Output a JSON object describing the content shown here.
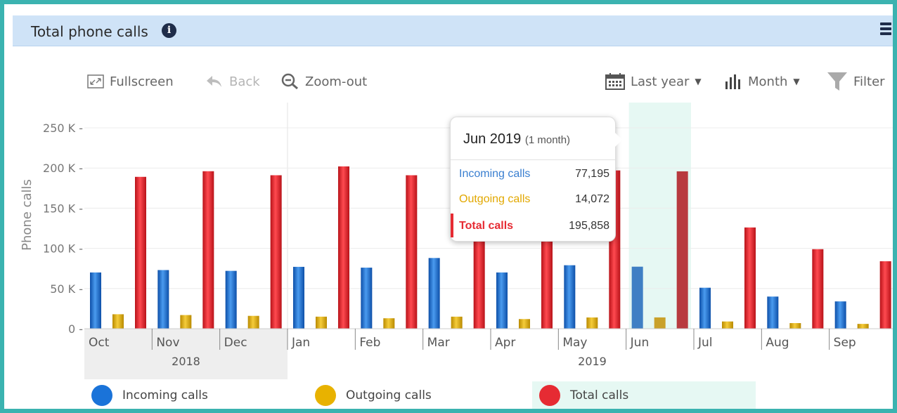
{
  "widget": {
    "title": "Total phone calls"
  },
  "toolbar": {
    "fullscreen": "Fullscreen",
    "back": "Back",
    "zoom_out": "Zoom-out",
    "period": "Last year",
    "granularity": "Month",
    "filter": "Filter"
  },
  "tooltip": {
    "title": "Jun 2019",
    "subtitle": "(1 month)",
    "rows": [
      {
        "label": "Incoming calls",
        "value": "77,195"
      },
      {
        "label": "Outgoing calls",
        "value": "14,072"
      },
      {
        "label": "Total calls",
        "value": "195,858"
      }
    ]
  },
  "colors": {
    "incoming": "#1a73d9",
    "outgoing": "#e8b200",
    "total": "#e62b33",
    "frame": "#3bb3b0",
    "header": "#cfe3f7"
  },
  "chart_data": {
    "type": "bar",
    "ylabel": "Phone calls",
    "ylim": [
      0,
      250000
    ],
    "yticks": [
      "0",
      "50 K",
      "100 K",
      "150 K",
      "200 K",
      "250 K"
    ],
    "categories": [
      "Oct",
      "Nov",
      "Dec",
      "Jan",
      "Feb",
      "Mar",
      "Apr",
      "May",
      "Jun",
      "Jul",
      "Aug",
      "Sep"
    ],
    "year_groups": [
      {
        "label": "2018",
        "months": 3
      },
      {
        "label": "2019",
        "months": 9
      }
    ],
    "highlighted_category": "Jun",
    "series": [
      {
        "name": "Incoming calls",
        "values": [
          70000,
          73000,
          72000,
          77000,
          76000,
          88000,
          70000,
          79000,
          77195,
          51000,
          40000,
          34000
        ]
      },
      {
        "name": "Outgoing calls",
        "values": [
          18000,
          17000,
          16000,
          15000,
          13000,
          15000,
          12000,
          14000,
          14072,
          9000,
          7000,
          6000
        ]
      },
      {
        "name": "Total calls",
        "values": [
          189000,
          196000,
          191000,
          202000,
          191000,
          190000,
          192000,
          197000,
          195858,
          126000,
          99000,
          84000
        ]
      }
    ]
  }
}
